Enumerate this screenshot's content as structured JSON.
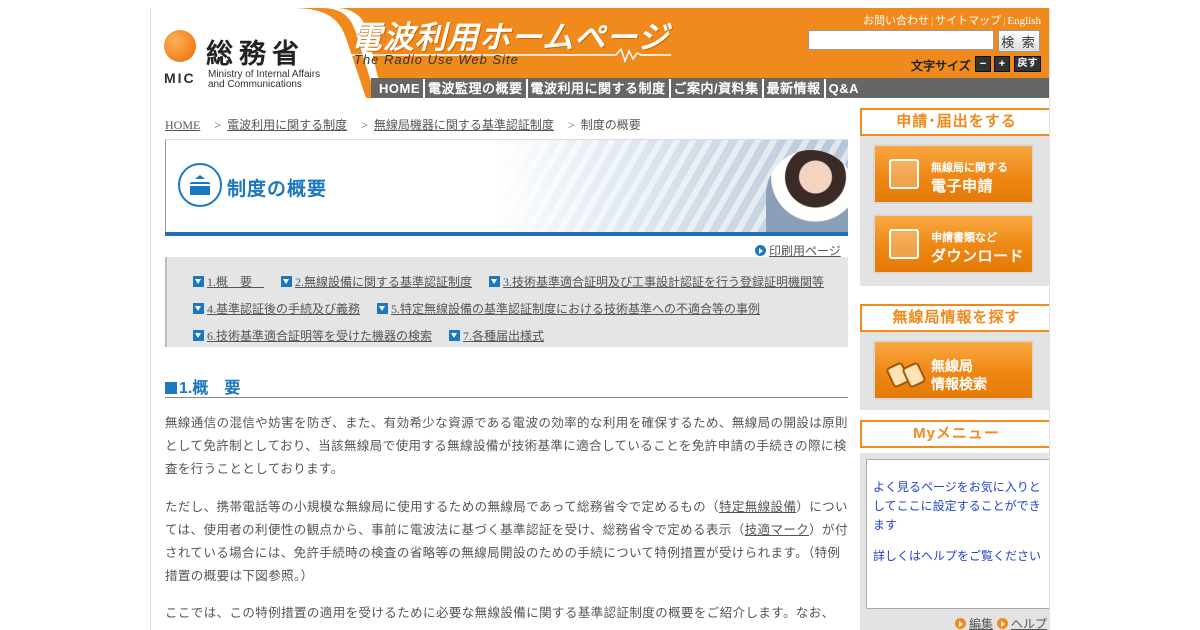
{
  "header": {
    "logo_ja": "総務省",
    "logo_abbr": "MIC",
    "logo_en_line1": "Ministry of Internal Affairs",
    "logo_en_line2": "and Communications",
    "site_title": "電波利用ホームページ",
    "site_subtitle": "The Radio Use Web Site",
    "util_links": [
      "お問い合わせ",
      "サイトマップ",
      "English"
    ],
    "search_placeholder": "",
    "search_button": "検 索",
    "fontsize_label": "文字サイズ",
    "fontsize_minus": "−",
    "fontsize_plus": "+",
    "fontsize_reset": "戻す",
    "nav": [
      "HOME",
      "電波監理の概要",
      "電波利用に関する制度",
      "ご案内/資料集",
      "最新情報",
      "Q&A"
    ]
  },
  "breadcrumb": {
    "home": "HOME",
    "level1": "電波利用に関する制度",
    "level2": "無線局機器に関する基準認証制度",
    "current": "制度の概要",
    "separator": ">"
  },
  "banner": {
    "title": "制度の概要"
  },
  "print_link": "印刷用ページ",
  "toc": {
    "row1": [
      "1.概　要　",
      "2.無線設備に関する基準認証制度",
      "3.技術基準適合証明及び工事設計認証を行う登録証明機関等"
    ],
    "row2": [
      "4.基準認証後の手続及び義務",
      "5.特定無線設備の基準認証制度における技術基準への不適合等の事例"
    ],
    "row3": [
      "6.技術基準適合証明等を受けた機器の検索",
      "7.各種届出様式"
    ]
  },
  "section": {
    "heading": "1.概　要"
  },
  "content": {
    "p1": "無線通信の混信や妨害を防ぎ、また、有効希少な資源である電波の効率的な利用を確保するため、無線局の開設は原則として免許制としており、当該無線局で使用する無線設備が技術基準に適合していることを免許申請の手続きの際に検査を行うこととしております。",
    "p2_a": "ただし、携帯電話等の小規模な無線局に使用するための無線局であって総務省令で定めるもの（",
    "p2_link1": "特定無線設備",
    "p2_b": "）については、使用者の利便性の観点から、事前に電波法に基づく基準認証を受け、総務省令で定める表示（",
    "p2_link2": "技適マーク",
    "p2_c": "）が付されている場合には、免許手続時の検査の省略等の無線局開設のための手続について特例措置が受けられます。（特例措置の概要は下図参照。）",
    "p3": "ここでは、この特例措置の適用を受けるために必要な無線設備に関する基準認証制度の概要をご紹介します。なお、"
  },
  "sidebar": {
    "apply_head": "申請･届出をする",
    "btn_eapp_l1": "無線局に関する",
    "btn_eapp_l2": "電子申請",
    "btn_dl_l1": "申請書類など",
    "btn_dl_l2": "ダウンロード",
    "search_head": "無線局情報を探す",
    "btn_search_l1": "無線局",
    "btn_search_l2": "情報検索",
    "my_head": "Myメニュー",
    "my_text1": "よく見るページをお気に入りとしてここに設定することができます",
    "my_text2": "詳しくはヘルプをご覧ください",
    "my_edit": "編集",
    "my_help": "ヘルプ"
  },
  "colors": {
    "accent_orange": "#f08a1c",
    "accent_blue": "#1a77c0",
    "nav_gray": "#666666"
  }
}
